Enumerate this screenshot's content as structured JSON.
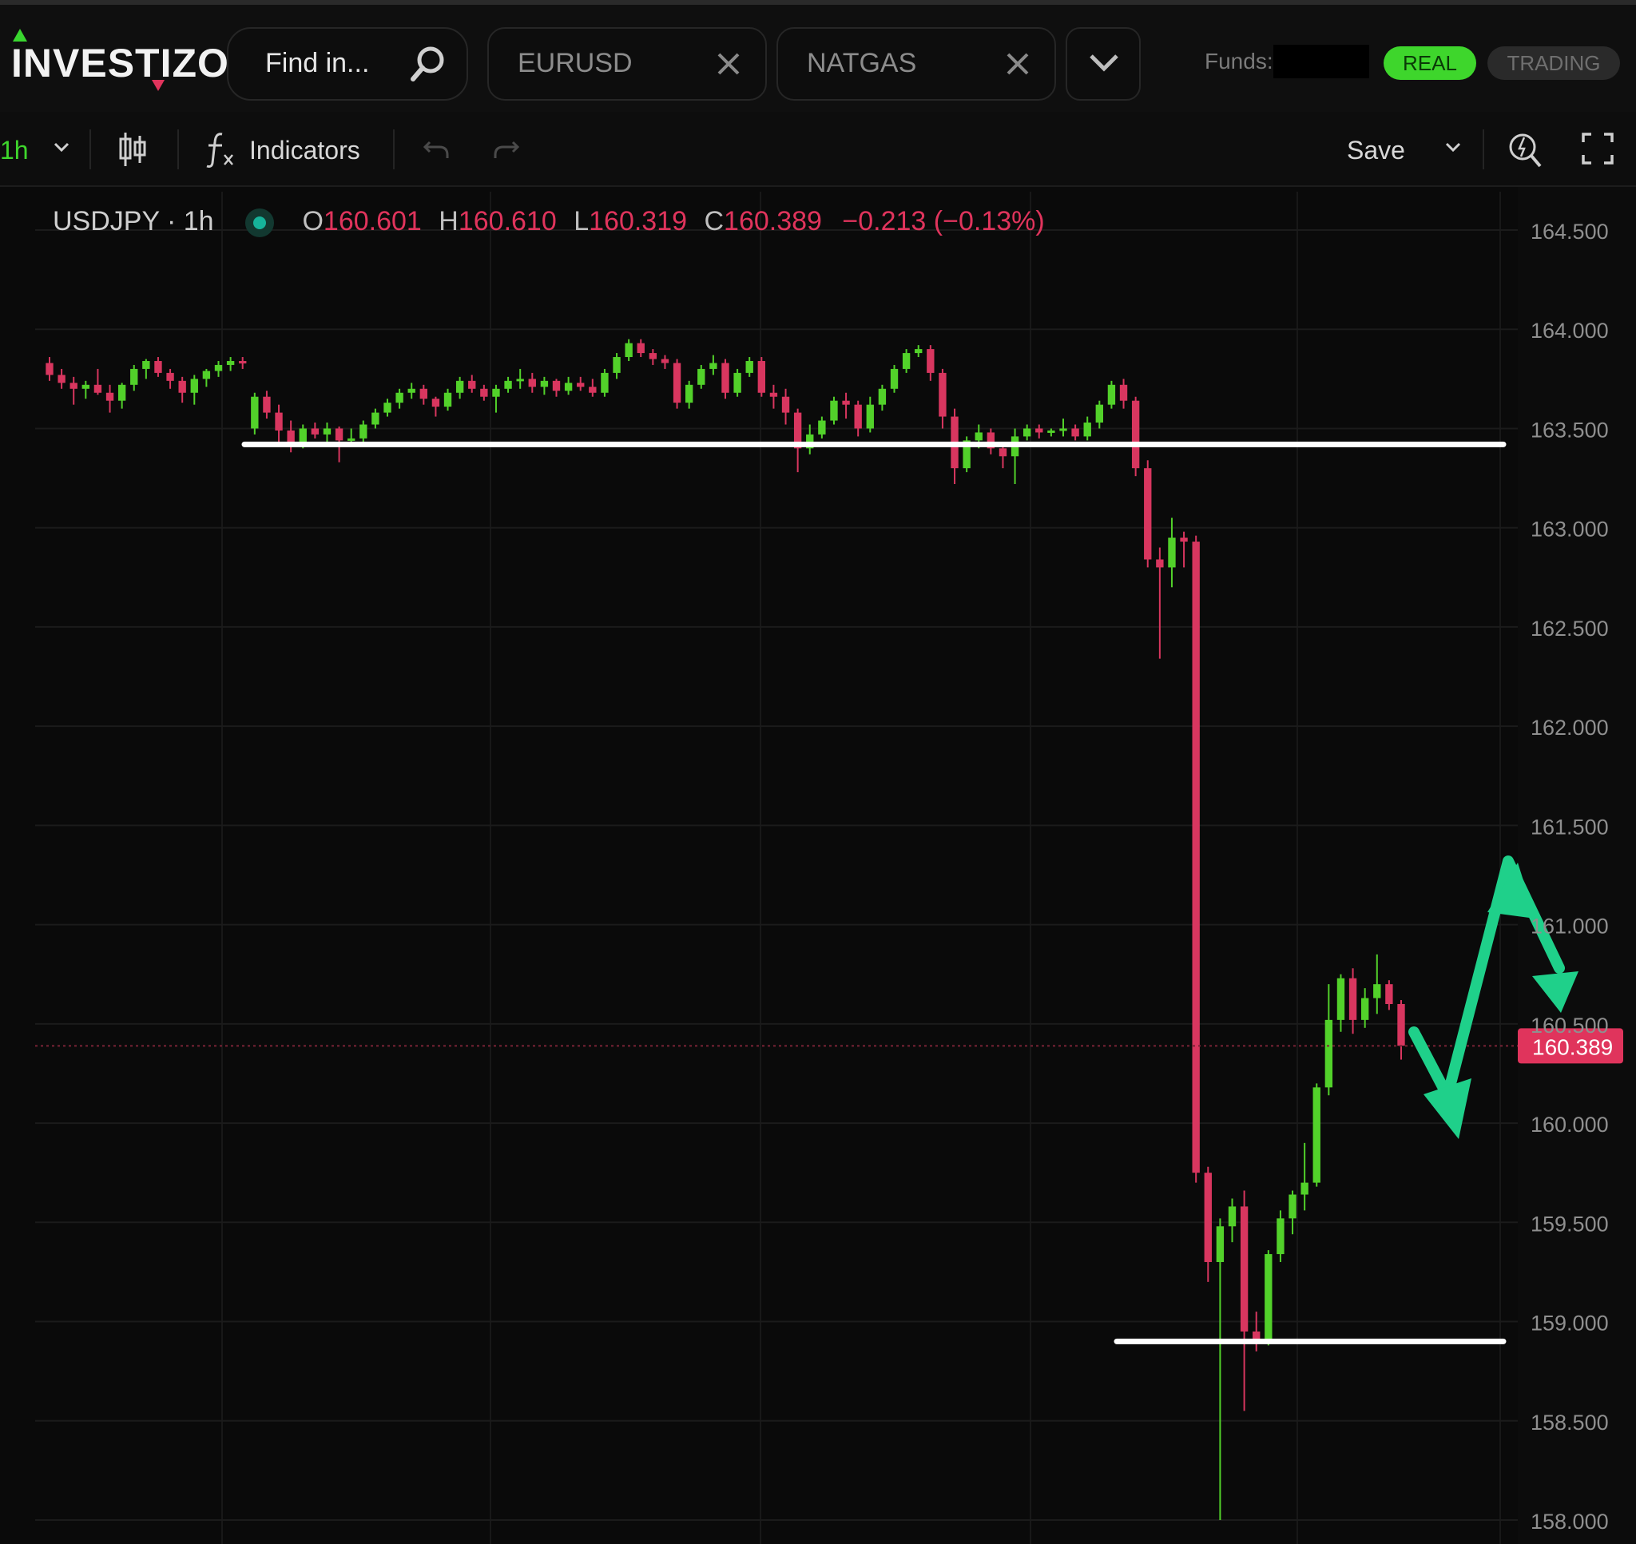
{
  "header": {
    "logo": "INVESTIZO",
    "search_placeholder": "Find in...",
    "tabs": [
      {
        "label": "EURUSD"
      },
      {
        "label": "NATGAS"
      }
    ],
    "funds_label": "Funds:",
    "mode_real": "REAL",
    "mode_trading": "TRADING",
    "colors": {
      "accent_green": "#3ed62c",
      "accent_red": "#e0345c"
    }
  },
  "toolbar": {
    "interval": "1h",
    "indicators_label": "Indicators",
    "save_label": "Save"
  },
  "legend": {
    "symbol": "USDJPY · 1h",
    "o_label": "O",
    "o_value": "160.601",
    "h_label": "H",
    "h_value": "160.610",
    "l_label": "L",
    "l_value": "160.319",
    "c_label": "C",
    "c_value": "160.389",
    "change": "−0.213 (−0.13%)"
  },
  "price_label": "160.389",
  "chart_data": {
    "type": "candlestick",
    "symbol": "USDJPY",
    "interval": "1h",
    "ylim": [
      158.0,
      164.5
    ],
    "y_ticks": [
      "164.500",
      "164.000",
      "163.500",
      "163.000",
      "162.500",
      "162.000",
      "161.500",
      "161.000",
      "160.500",
      "160.000",
      "159.500",
      "159.000",
      "158.500",
      "158.000"
    ],
    "current_price": 160.389,
    "colors": {
      "up": "#52d12a",
      "down": "#d8365f"
    },
    "annotations": {
      "support_resistance_lines": [
        163.42,
        158.9
      ],
      "projected_path_color": "#1fd08a"
    },
    "candles": [
      [
        163.83,
        163.86,
        163.74,
        163.77
      ],
      [
        163.77,
        163.8,
        163.7,
        163.73
      ],
      [
        163.73,
        163.76,
        163.62,
        163.7
      ],
      [
        163.7,
        163.74,
        163.65,
        163.72
      ],
      [
        163.72,
        163.8,
        163.67,
        163.68
      ],
      [
        163.68,
        163.72,
        163.58,
        163.64
      ],
      [
        163.64,
        163.73,
        163.6,
        163.72
      ],
      [
        163.72,
        163.82,
        163.69,
        163.8
      ],
      [
        163.8,
        163.85,
        163.75,
        163.84
      ],
      [
        163.84,
        163.86,
        163.76,
        163.78
      ],
      [
        163.78,
        163.8,
        163.7,
        163.74
      ],
      [
        163.74,
        163.76,
        163.63,
        163.68
      ],
      [
        163.68,
        163.77,
        163.62,
        163.75
      ],
      [
        163.75,
        163.8,
        163.71,
        163.79
      ],
      [
        163.79,
        163.84,
        163.76,
        163.82
      ],
      [
        163.82,
        163.86,
        163.79,
        163.84
      ],
      [
        163.84,
        163.86,
        163.8,
        163.83
      ],
      [
        163.5,
        163.68,
        163.47,
        163.66
      ],
      [
        163.66,
        163.69,
        163.55,
        163.58
      ],
      [
        163.58,
        163.62,
        163.42,
        163.49
      ],
      [
        163.49,
        163.54,
        163.38,
        163.43
      ],
      [
        163.43,
        163.52,
        163.4,
        163.5
      ],
      [
        163.5,
        163.53,
        163.45,
        163.47
      ],
      [
        163.47,
        163.53,
        163.43,
        163.5
      ],
      [
        163.5,
        163.51,
        163.33,
        163.44
      ],
      [
        163.44,
        163.5,
        163.42,
        163.45
      ],
      [
        163.45,
        163.54,
        163.43,
        163.52
      ],
      [
        163.52,
        163.6,
        163.5,
        163.58
      ],
      [
        163.58,
        163.65,
        163.56,
        163.63
      ],
      [
        163.63,
        163.7,
        163.6,
        163.68
      ],
      [
        163.68,
        163.73,
        163.65,
        163.7
      ],
      [
        163.7,
        163.72,
        163.62,
        163.65
      ],
      [
        163.65,
        163.66,
        163.56,
        163.61
      ],
      [
        163.61,
        163.7,
        163.59,
        163.68
      ],
      [
        163.68,
        163.76,
        163.65,
        163.74
      ],
      [
        163.74,
        163.77,
        163.68,
        163.7
      ],
      [
        163.7,
        163.72,
        163.64,
        163.66
      ],
      [
        163.66,
        163.72,
        163.58,
        163.7
      ],
      [
        163.7,
        163.76,
        163.68,
        163.74
      ],
      [
        163.74,
        163.8,
        163.7,
        163.75
      ],
      [
        163.75,
        163.78,
        163.68,
        163.71
      ],
      [
        163.71,
        163.76,
        163.67,
        163.74
      ],
      [
        163.74,
        163.75,
        163.66,
        163.69
      ],
      [
        163.69,
        163.76,
        163.67,
        163.73
      ],
      [
        163.73,
        163.76,
        163.69,
        163.71
      ],
      [
        163.71,
        163.75,
        163.66,
        163.68
      ],
      [
        163.68,
        163.8,
        163.66,
        163.78
      ],
      [
        163.78,
        163.88,
        163.75,
        163.86
      ],
      [
        163.86,
        163.95,
        163.84,
        163.93
      ],
      [
        163.93,
        163.95,
        163.86,
        163.88
      ],
      [
        163.88,
        163.9,
        163.82,
        163.85
      ],
      [
        163.85,
        163.87,
        163.8,
        163.83
      ],
      [
        163.83,
        163.85,
        163.6,
        163.63
      ],
      [
        163.63,
        163.74,
        163.6,
        163.72
      ],
      [
        163.72,
        163.82,
        163.7,
        163.8
      ],
      [
        163.8,
        163.87,
        163.77,
        163.83
      ],
      [
        163.83,
        163.85,
        163.65,
        163.68
      ],
      [
        163.68,
        163.8,
        163.66,
        163.78
      ],
      [
        163.78,
        163.86,
        163.76,
        163.84
      ],
      [
        163.84,
        163.86,
        163.66,
        163.68
      ],
      [
        163.68,
        163.72,
        163.6,
        163.66
      ],
      [
        163.66,
        163.7,
        163.52,
        163.58
      ],
      [
        163.58,
        163.6,
        163.28,
        163.4
      ],
      [
        163.4,
        163.52,
        163.37,
        163.47
      ],
      [
        163.47,
        163.56,
        163.45,
        163.54
      ],
      [
        163.54,
        163.66,
        163.52,
        163.64
      ],
      [
        163.64,
        163.68,
        163.55,
        163.62
      ],
      [
        163.62,
        163.64,
        163.46,
        163.5
      ],
      [
        163.5,
        163.66,
        163.48,
        163.62
      ],
      [
        163.62,
        163.72,
        163.59,
        163.7
      ],
      [
        163.7,
        163.82,
        163.68,
        163.8
      ],
      [
        163.8,
        163.9,
        163.78,
        163.88
      ],
      [
        163.88,
        163.92,
        163.86,
        163.9
      ],
      [
        163.9,
        163.92,
        163.74,
        163.78
      ],
      [
        163.78,
        163.8,
        163.5,
        163.56
      ],
      [
        163.56,
        163.6,
        163.22,
        163.3
      ],
      [
        163.3,
        163.46,
        163.28,
        163.44
      ],
      [
        163.44,
        163.52,
        163.4,
        163.48
      ],
      [
        163.48,
        163.5,
        163.37,
        163.4
      ],
      [
        163.4,
        163.42,
        163.3,
        163.36
      ],
      [
        163.36,
        163.5,
        163.22,
        163.46
      ],
      [
        163.46,
        163.52,
        163.44,
        163.5
      ],
      [
        163.5,
        163.52,
        163.45,
        163.48
      ],
      [
        163.48,
        163.5,
        163.46,
        163.49
      ],
      [
        163.49,
        163.55,
        163.46,
        163.5
      ],
      [
        163.5,
        163.52,
        163.44,
        163.46
      ],
      [
        163.46,
        163.56,
        163.44,
        163.53
      ],
      [
        163.53,
        163.64,
        163.5,
        163.62
      ],
      [
        163.62,
        163.74,
        163.6,
        163.72
      ],
      [
        163.72,
        163.75,
        163.6,
        163.64
      ],
      [
        163.64,
        163.66,
        163.26,
        163.3
      ],
      [
        163.3,
        163.34,
        162.8,
        162.84
      ],
      [
        162.84,
        162.9,
        162.34,
        162.8
      ],
      [
        162.8,
        163.05,
        162.7,
        162.95
      ],
      [
        162.95,
        162.98,
        162.8,
        162.93
      ],
      [
        162.93,
        162.96,
        159.7,
        159.75
      ],
      [
        159.75,
        159.78,
        159.2,
        159.3
      ],
      [
        159.3,
        159.52,
        158.0,
        159.48
      ],
      [
        159.48,
        159.62,
        159.4,
        159.58
      ],
      [
        159.58,
        159.66,
        158.55,
        158.95
      ],
      [
        158.95,
        159.05,
        158.85,
        158.9
      ],
      [
        158.9,
        159.36,
        158.88,
        159.34
      ],
      [
        159.34,
        159.56,
        159.3,
        159.52
      ],
      [
        159.52,
        159.66,
        159.44,
        159.64
      ],
      [
        159.64,
        159.9,
        159.56,
        159.7
      ],
      [
        159.7,
        160.2,
        159.68,
        160.18
      ],
      [
        160.18,
        160.7,
        160.14,
        160.52
      ],
      [
        160.52,
        160.75,
        160.46,
        160.73
      ],
      [
        160.73,
        160.78,
        160.45,
        160.52
      ],
      [
        160.52,
        160.68,
        160.48,
        160.63
      ],
      [
        160.63,
        160.85,
        160.55,
        160.7
      ],
      [
        160.7,
        160.72,
        160.57,
        160.6
      ],
      [
        160.6,
        160.62,
        160.32,
        160.39
      ]
    ]
  }
}
